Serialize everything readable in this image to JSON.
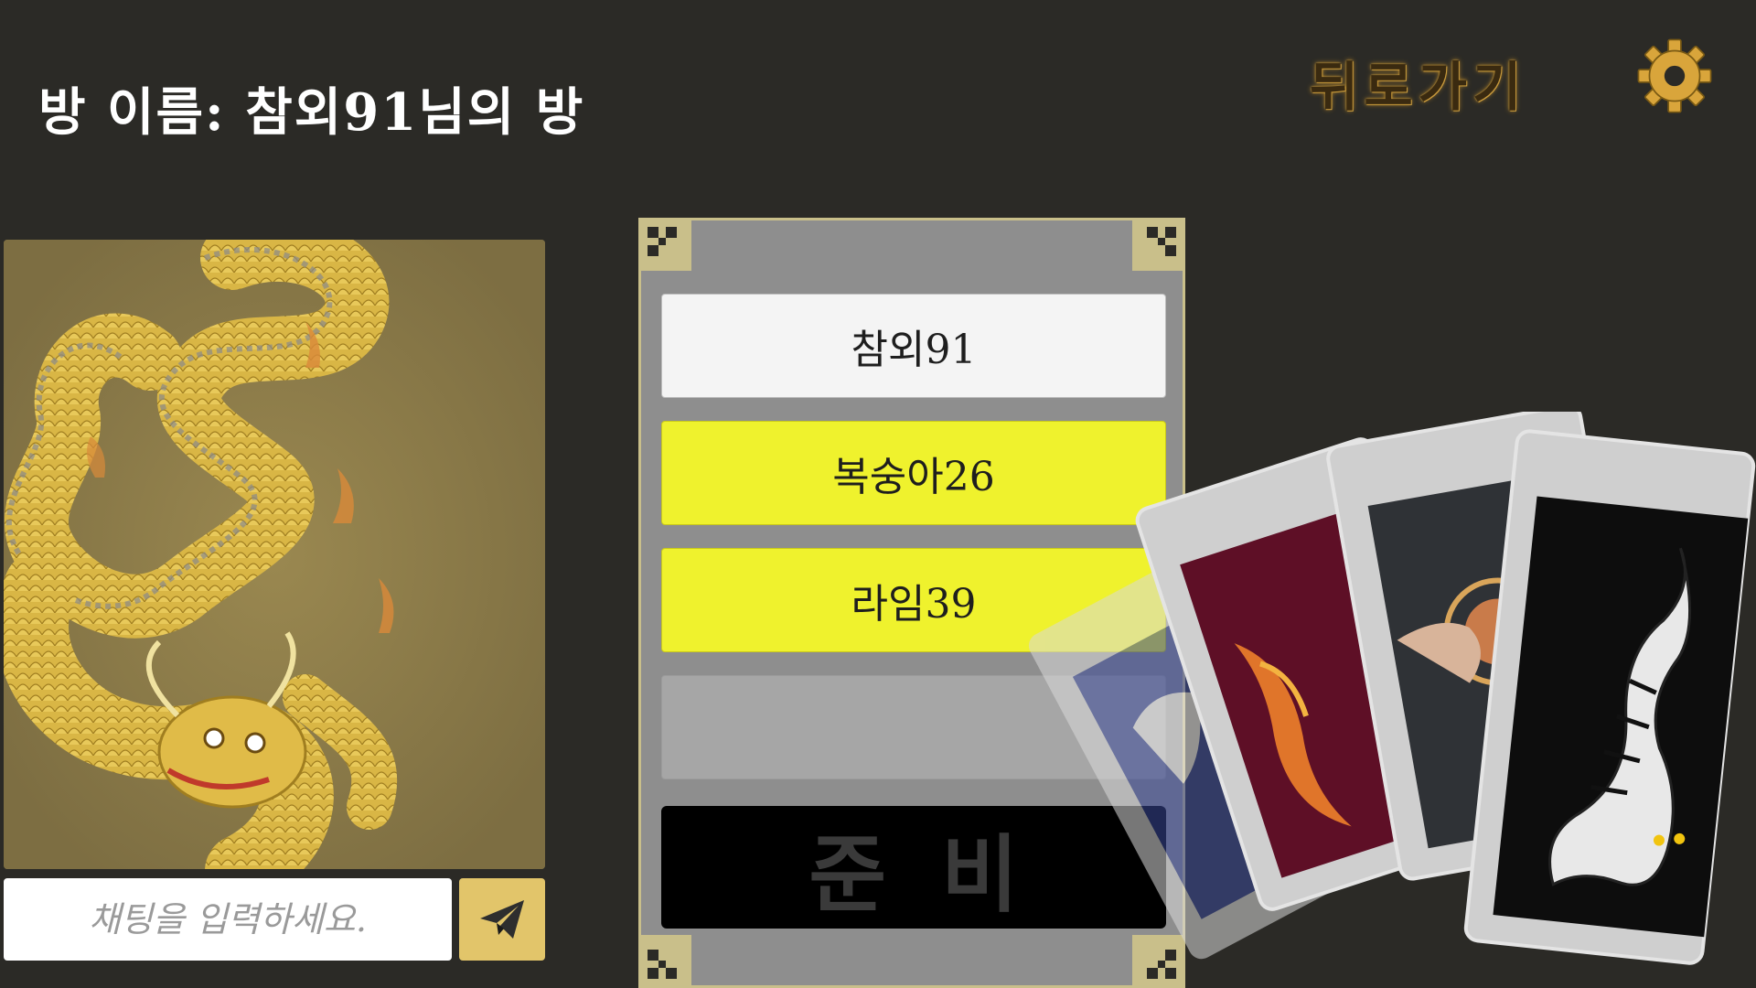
{
  "room": {
    "title": "방 이름: 참외91님의 방"
  },
  "header": {
    "back_label": "뒤로가기",
    "settings_icon": "gear-icon"
  },
  "chat": {
    "placeholder": "채팅을 입력하세요.",
    "send_icon": "paper-plane-icon"
  },
  "players": [
    {
      "name": "참외91",
      "status": "host"
    },
    {
      "name": "복숭아26",
      "status": "ready"
    },
    {
      "name": "라임39",
      "status": "ready"
    },
    {
      "name": "",
      "status": "empty"
    }
  ],
  "ready_button": {
    "label": "준비"
  },
  "colors": {
    "background": "#2b2a26",
    "ready_yellow": "#eff22d",
    "host_white": "#f4f4f4",
    "empty_gray": "#a6a6a6",
    "panel_gray": "#8e8e8e",
    "send_button": "#e2c56a",
    "dragon_panel": "#7d6e42"
  }
}
